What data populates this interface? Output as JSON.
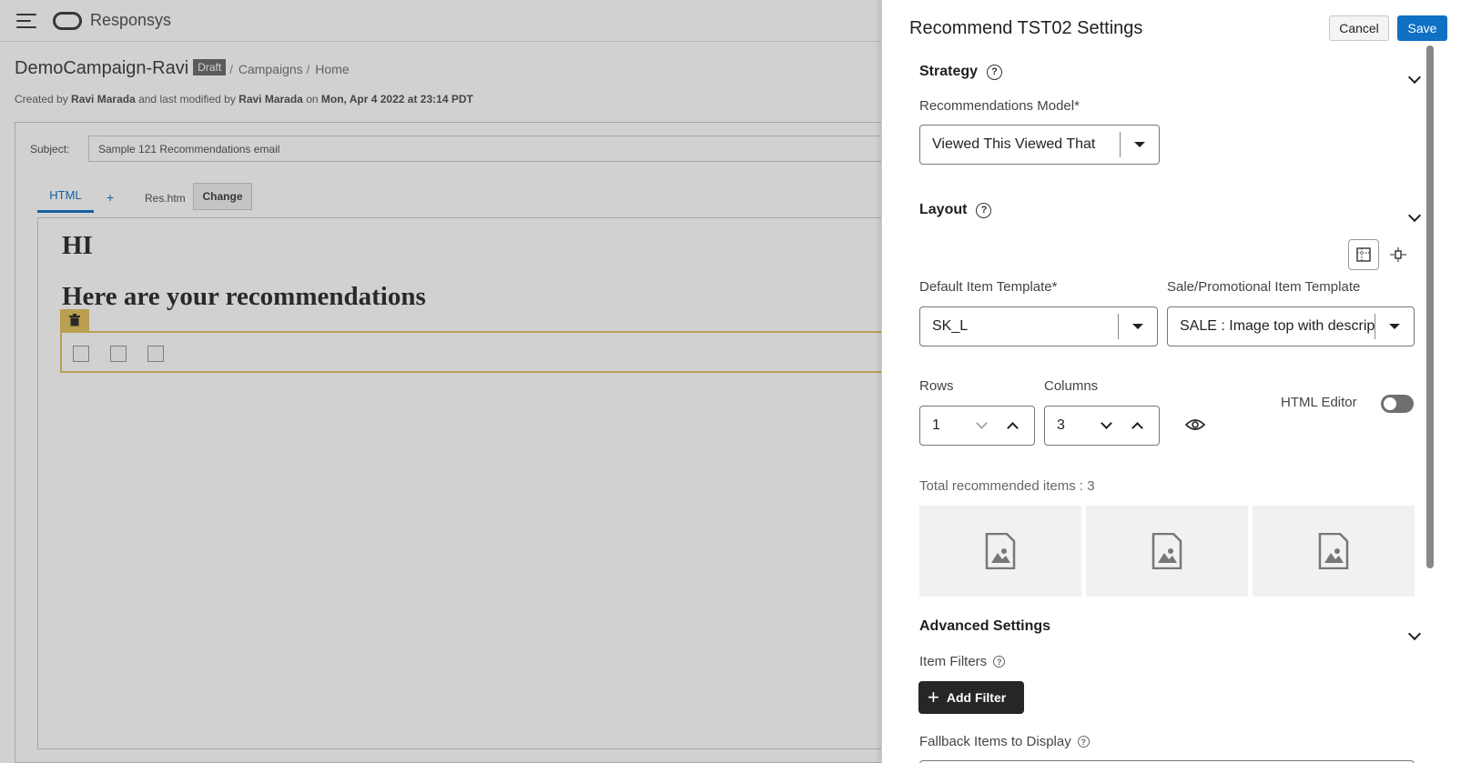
{
  "app": {
    "brand": "Responsys",
    "campaign_title": "DemoCampaign-Ravi",
    "status_badge": "Draft",
    "breadcrumbs": [
      "Campaigns",
      "Home"
    ],
    "meta": {
      "prefix": "Created by ",
      "creator": "Ravi Marada",
      "mid": " and last modified by ",
      "modifier": "Ravi Marada",
      "on": " on ",
      "date": "Mon, Apr 4 2022 at 23:14 PDT"
    },
    "subject_label": "Subject:",
    "subject_value": "Sample 121 Recommendations email",
    "tab_html": "HTML",
    "tab_add": "+",
    "file_name": "Res.htm",
    "change_label": "Change",
    "content": {
      "heading1": "HI",
      "heading2": "Here are your recommendations"
    }
  },
  "drawer": {
    "title": "Recommend TST02 Settings",
    "cancel_label": "Cancel",
    "save_label": "Save",
    "strategy": {
      "title": "Strategy",
      "model_label": "Recommendations Model*",
      "model_value": "Viewed This Viewed That"
    },
    "layout": {
      "title": "Layout",
      "default_template_label": "Default Item Template*",
      "default_template_value": "SK_L",
      "sale_template_label": "Sale/Promotional Item Template",
      "sale_template_value": "SALE : Image top with description",
      "rows_label": "Rows",
      "rows_value": "1",
      "columns_label": "Columns",
      "columns_value": "3",
      "html_editor_label": "HTML Editor",
      "html_editor_on": false,
      "total_label": "Total recommended items : 3"
    },
    "advanced": {
      "title": "Advanced Settings",
      "item_filters_label": "Item Filters",
      "add_filter_label": "Add Filter",
      "fallback_label": "Fallback Items to Display"
    }
  },
  "colors": {
    "primary": "#0f70c4",
    "highlight": "#e3c364",
    "dark_button": "#262626"
  }
}
